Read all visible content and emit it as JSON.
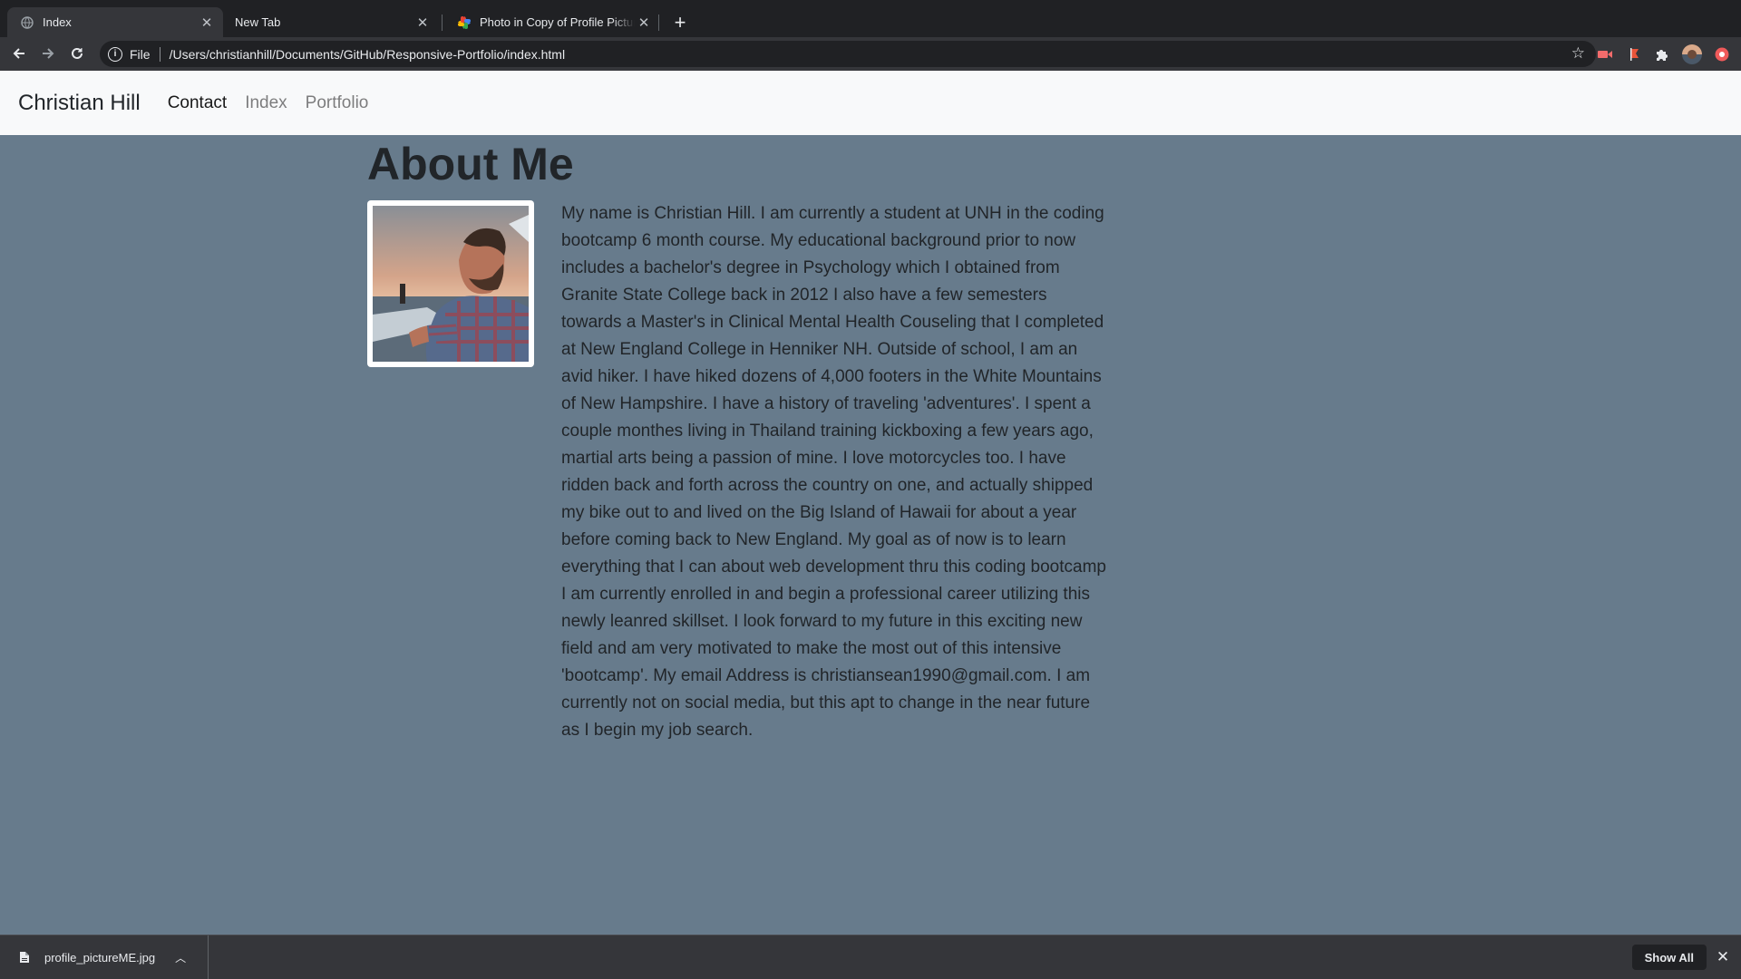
{
  "browser": {
    "tabs": [
      {
        "title": "Index",
        "active": true
      },
      {
        "title": "New Tab",
        "active": false
      },
      {
        "title": "Photo in Copy of Profile Pictures",
        "active": false
      }
    ],
    "address": {
      "scheme": "File",
      "url": "/Users/christianhill/Documents/GitHub/Responsive-Portfolio/index.html"
    }
  },
  "site": {
    "brand": "Christian Hill",
    "nav": [
      {
        "label": "Contact",
        "active": true
      },
      {
        "label": "Index",
        "active": false
      },
      {
        "label": "Portfolio",
        "active": false
      }
    ],
    "heading": "About Me",
    "bio": "My name is Christian Hill. I am currently a student at UNH in the coding bootcamp 6 month course. My educational background prior to now includes a bachelor's degree in Psychology which I obtained from Granite State College back in 2012 I also have a few semesters towards a Master's in Clinical Mental Health Couseling that I completed at New England College in Henniker NH. Outside of school, I am an avid hiker. I have hiked dozens of 4,000 footers in the White Mountains of New Hampshire. I have a history of traveling 'adventures'. I spent a couple monthes living in Thailand training kickboxing a few years ago, martial arts being a passion of mine. I love motorcycles too. I have ridden back and forth across the country on one, and actually shipped my bike out to and lived on the Big Island of Hawaii for about a year before coming back to New England. My goal as of now is to learn everything that I can about web development thru this coding bootcamp I am currently enrolled in and begin a professional career utilizing this newly leanred skillset. I look forward to my future in this exciting new field and am very motivated to make the most out of this intensive 'bootcamp'. My email Address is christiansean1990@gmail.com. I am currently not on social media, but this apt to change in the near future as I begin my job search."
  },
  "downloads": {
    "file_name": "profile_pictureME.jpg",
    "show_all_label": "Show All"
  },
  "colors": {
    "page_background": "#677b8c",
    "navbar_background": "#f8f9fa",
    "chrome_dark": "#202124",
    "chrome_toolbar": "#35363a"
  },
  "icons": {
    "back": "arrow-left-icon",
    "forward": "arrow-right-icon",
    "reload": "reload-icon",
    "info": "info-icon",
    "bookmark": "star-icon",
    "extensions": "puzzle-icon"
  }
}
